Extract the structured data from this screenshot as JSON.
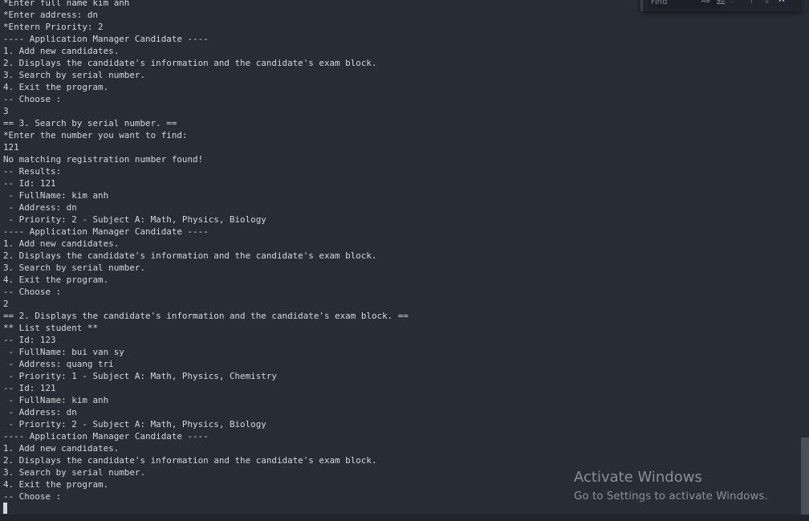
{
  "terminal": {
    "lines": [
      "*Enter full name kim anh",
      "*Enter address: dn",
      "*Entern Priority: 2",
      "---- Application Manager Candidate ----",
      "1. Add new candidates.",
      "2. Displays the candidate's information and the candidate's exam block.",
      "3. Search by serial number.",
      "4. Exit the program.",
      "-- Choose :",
      "3",
      "== 3. Search by serial number. ==",
      "*Enter the number you want to find:",
      "121",
      "No matching registration number found!",
      "-- Results:",
      "-- Id: 121",
      " - FullName: kim anh",
      " - Address: dn",
      " - Priority: 2 - Subject A: Math, Physics, Biology",
      "---- Application Manager Candidate ----",
      "1. Add new candidates.",
      "2. Displays the candidate's information and the candidate's exam block.",
      "3. Search by serial number.",
      "4. Exit the program.",
      "-- Choose :",
      "2",
      "== 2. Displays the candidate's information and the candidate's exam block. ==",
      "** List student **",
      "-- Id: 123",
      " - FullName: bui van sy",
      " - Address: quang tri",
      " - Priority: 1 - Subject A: Math, Physics, Chemistry",
      "-- Id: 121",
      " - FullName: kim anh",
      " - Address: dn",
      " - Priority: 2 - Subject A: Math, Physics, Biology",
      "---- Application Manager Candidate ----",
      "1. Add new candidates.",
      "2. Displays the candidate's information and the candidate's exam block.",
      "3. Search by serial number.",
      "4. Exit the program.",
      "-- Choose :"
    ]
  },
  "find_widget": {
    "placeholder": "Find",
    "match_case_label": "Aa",
    "whole_word_label": "ab",
    "regex_label": ".*",
    "prev_icon": "arrow-up-icon",
    "next_icon": "arrow-down-icon",
    "close_icon": "close-icon"
  },
  "watermark": {
    "title": "Activate Windows",
    "subtitle": "Go to Settings to activate Windows."
  },
  "colors": {
    "background": "#282c34",
    "text": "#d4d7dc",
    "watermark": "#8b9099"
  }
}
